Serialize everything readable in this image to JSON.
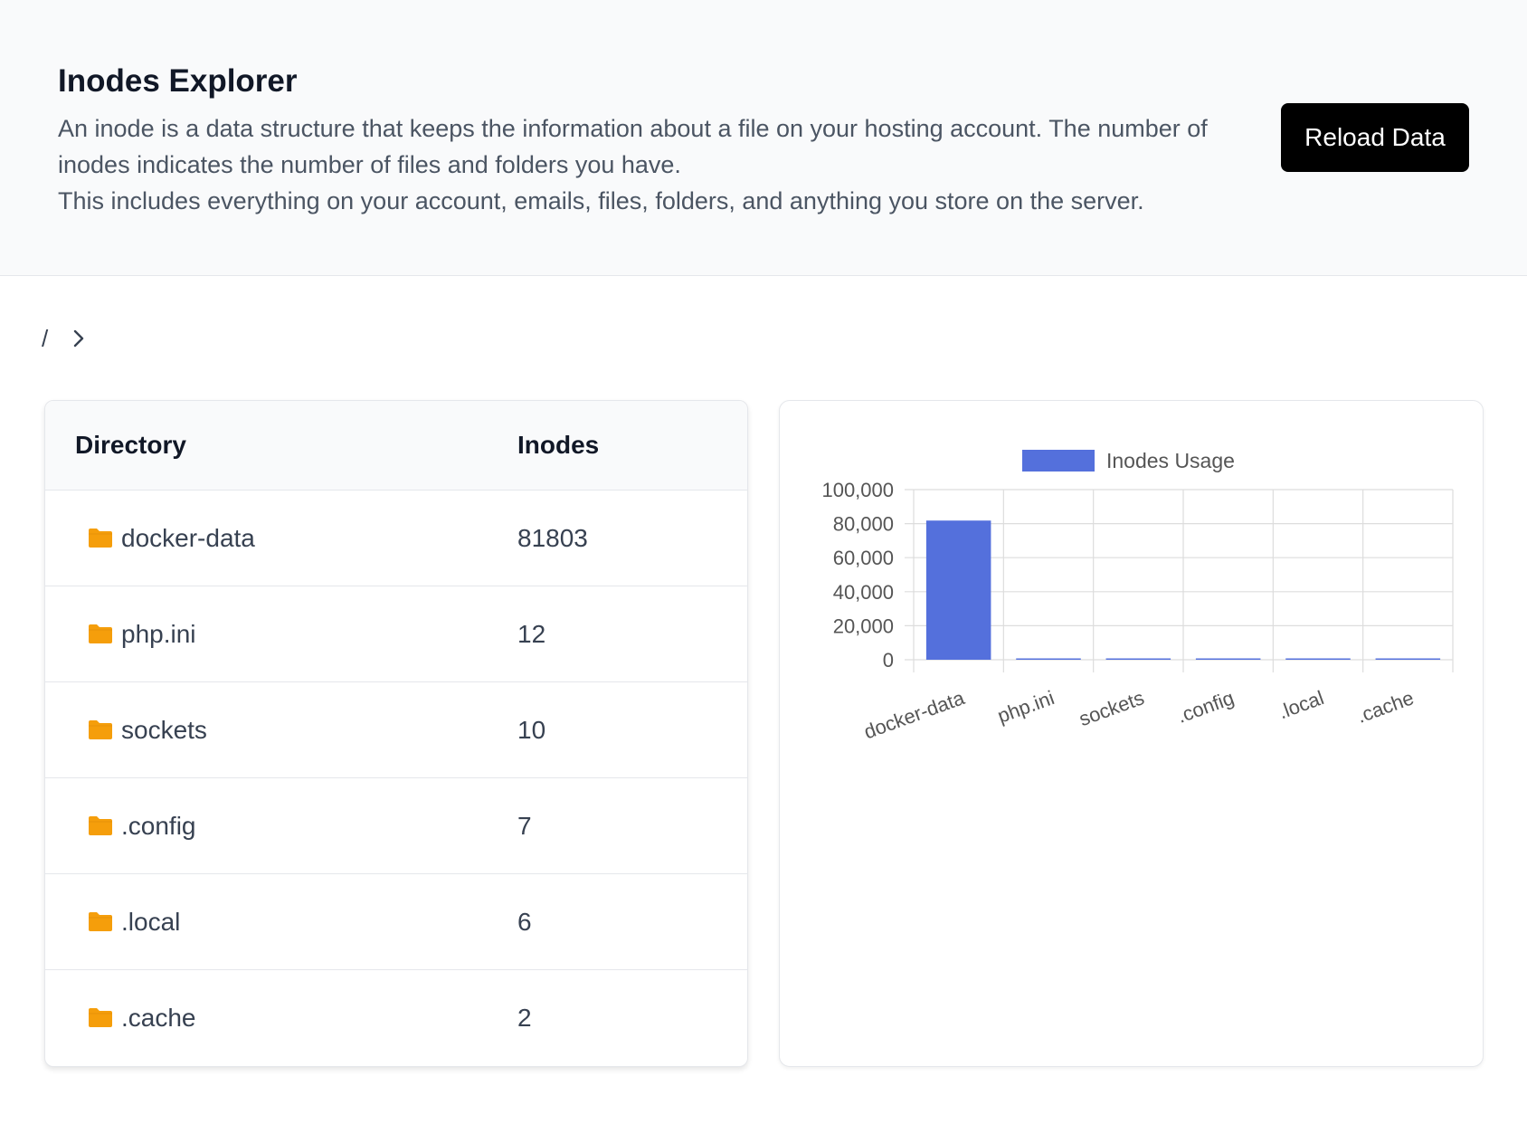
{
  "header": {
    "title": "Inodes Explorer",
    "description_line1": "An inode is a data structure that keeps the information about a file on your hosting account. The number of inodes indicates the number of files and folders you have.",
    "description_line2": "This includes everything on your account, emails, files, folders, and anything you store on the server.",
    "reload_label": "Reload Data"
  },
  "breadcrumb": {
    "root": "/"
  },
  "table": {
    "columns": [
      "Directory",
      "Inodes"
    ],
    "rows": [
      {
        "name": "docker-data",
        "inodes": "81803"
      },
      {
        "name": "php.ini",
        "inodes": "12"
      },
      {
        "name": "sockets",
        "inodes": "10"
      },
      {
        "name": ".config",
        "inodes": "7"
      },
      {
        "name": ".local",
        "inodes": "6"
      },
      {
        "name": ".cache",
        "inodes": "2"
      }
    ]
  },
  "colors": {
    "folder": "#f59e0b",
    "bar": "#5470dc",
    "button": "#000000"
  },
  "chart_data": {
    "type": "bar",
    "categories": [
      "docker-data",
      "php.ini",
      "sockets",
      ".config",
      ".local",
      ".cache"
    ],
    "series": [
      {
        "name": "Inodes Usage",
        "values": [
          81803,
          12,
          10,
          7,
          6,
          2
        ]
      }
    ],
    "ylim": [
      0,
      100000
    ],
    "yticks": [
      "0",
      "20,000",
      "40,000",
      "60,000",
      "80,000",
      "100,000"
    ],
    "grid": true,
    "legend": "top"
  }
}
